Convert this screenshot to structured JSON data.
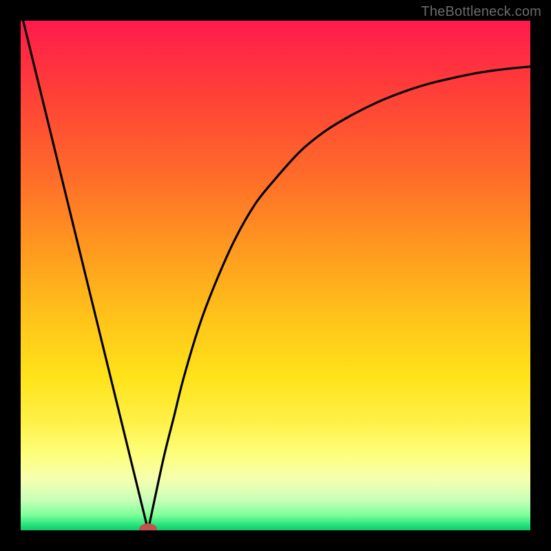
{
  "source_label": "TheBottleneck.com",
  "colors": {
    "frame": "#000000",
    "curve": "#000000",
    "marker": "#c0544a",
    "gradient_top": "#ff1a4d",
    "gradient_bottom": "#18c968"
  },
  "chart_data": {
    "type": "line",
    "title": "",
    "xlabel": "",
    "ylabel": "",
    "xlim": [
      0,
      100
    ],
    "ylim": [
      0,
      100
    ],
    "min_point": {
      "x": 25,
      "y": 0
    },
    "left_branch": {
      "x": [
        0,
        25
      ],
      "y": [
        102,
        0
      ]
    },
    "right_branch_x": [
      25,
      28,
      30,
      32,
      35,
      38,
      42,
      46,
      50,
      55,
      60,
      65,
      70,
      75,
      80,
      85,
      90,
      95,
      100
    ],
    "right_branch_y": [
      0,
      14,
      22,
      30,
      40,
      48,
      57,
      64,
      69,
      74.5,
      78.5,
      81.5,
      84,
      86,
      87.6,
      88.8,
      89.8,
      90.5,
      91
    ]
  }
}
